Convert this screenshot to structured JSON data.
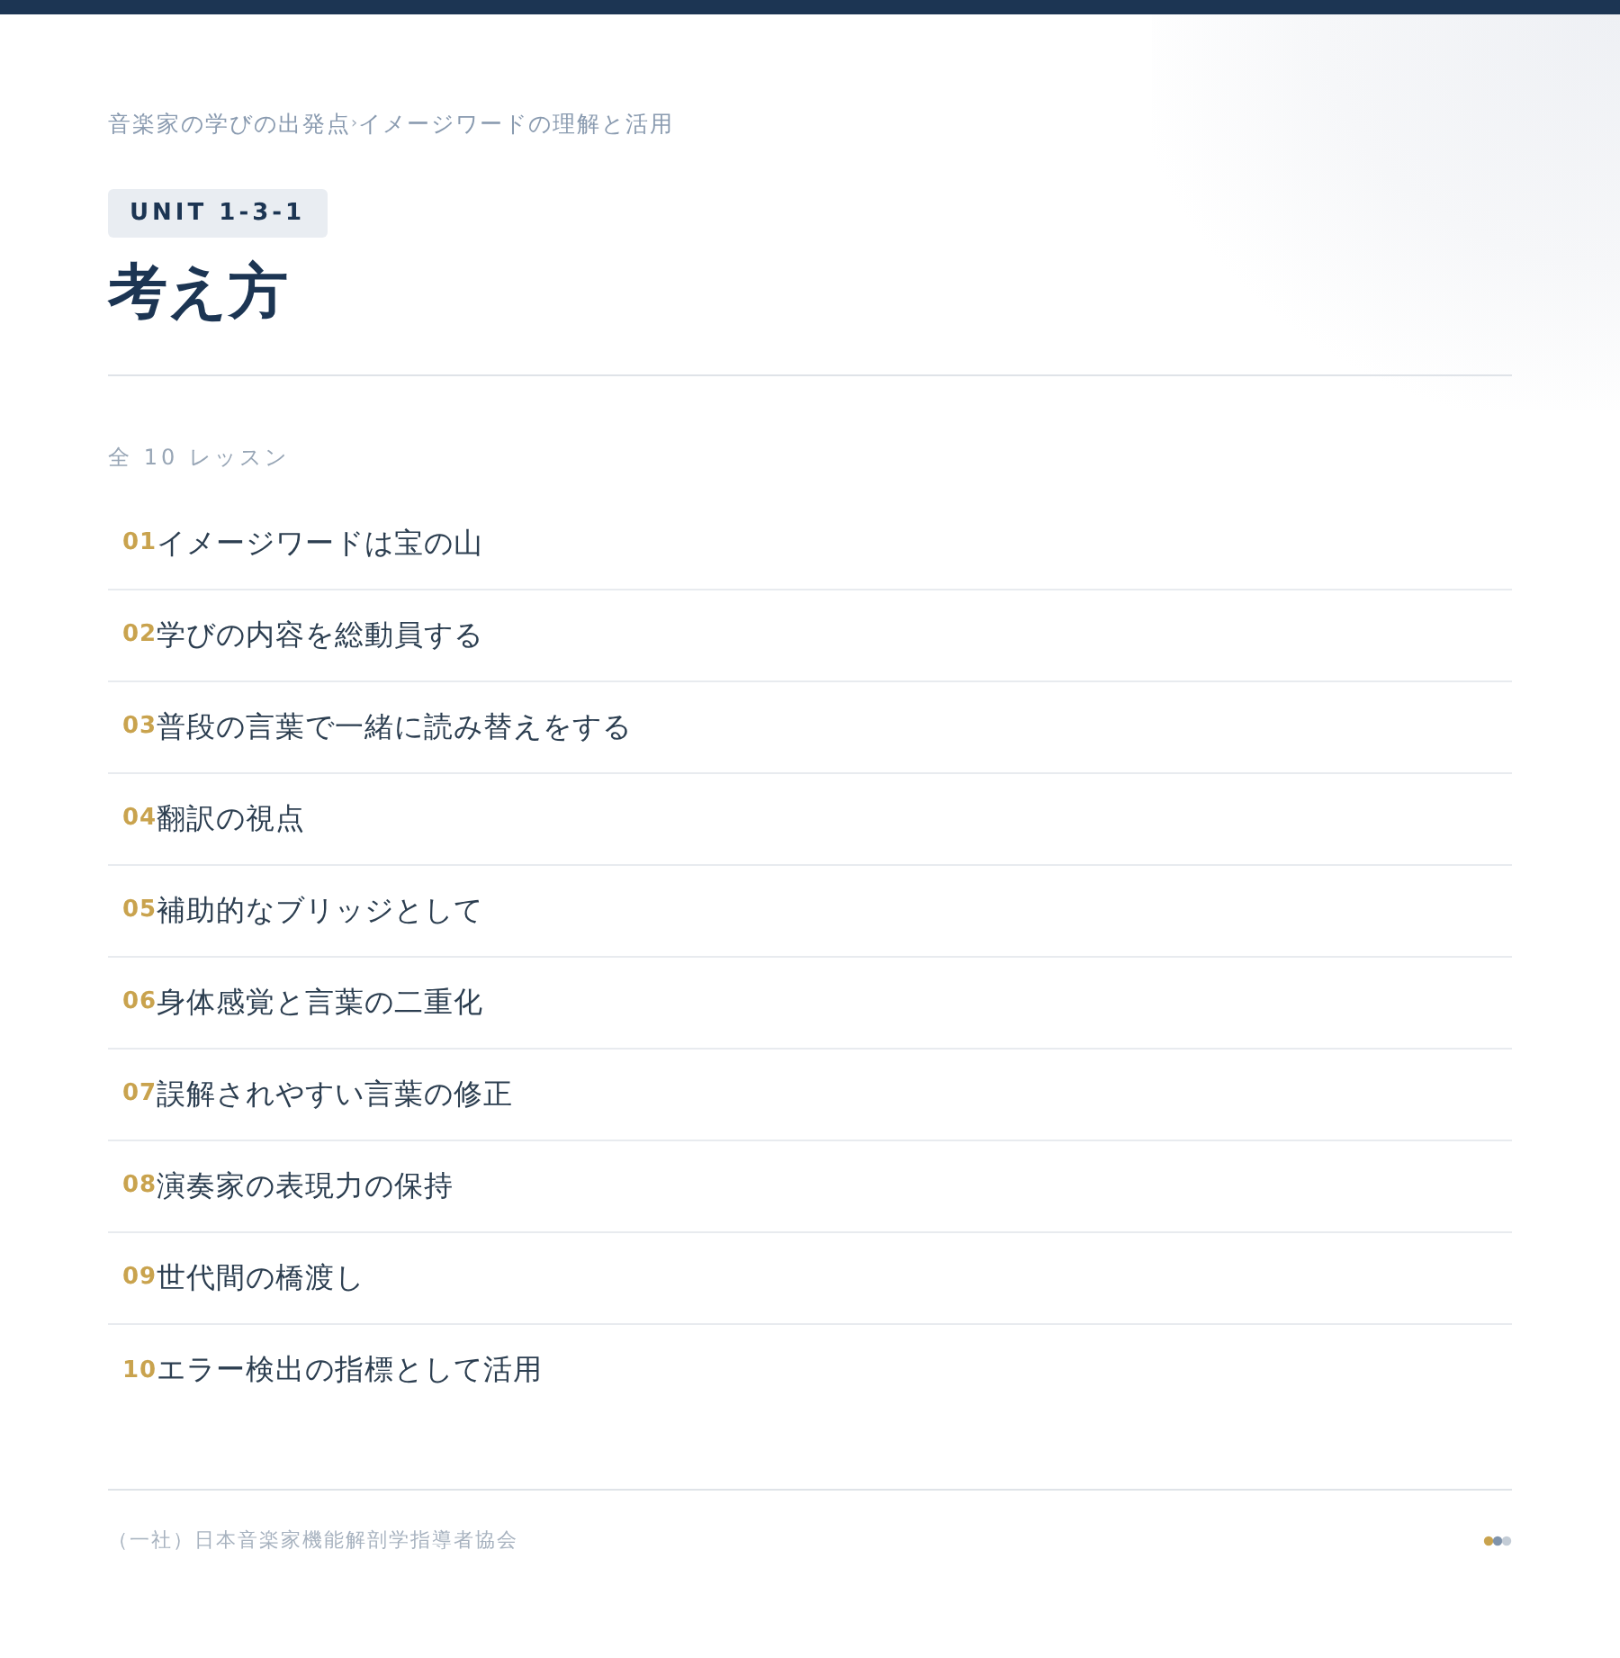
{
  "breadcrumb": {
    "items": [
      "音楽家の学びの出発点",
      "イメージワードの理解と活用"
    ],
    "separator": "›"
  },
  "unit_badge": "UNIT 1-3-1",
  "title": "考え方",
  "lesson_count": "全 10 レッスン",
  "lessons": [
    {
      "number": "01",
      "title": "イメージワードは宝の山"
    },
    {
      "number": "02",
      "title": "学びの内容を総動員する"
    },
    {
      "number": "03",
      "title": "普段の言葉で一緒に読み替えをする"
    },
    {
      "number": "04",
      "title": "翻訳の視点"
    },
    {
      "number": "05",
      "title": "補助的なブリッジとして"
    },
    {
      "number": "06",
      "title": "身体感覚と言葉の二重化"
    },
    {
      "number": "07",
      "title": "誤解されやすい言葉の修正"
    },
    {
      "number": "08",
      "title": "演奏家の表現力の保持"
    },
    {
      "number": "09",
      "title": "世代間の橋渡し"
    },
    {
      "number": "10",
      "title": "エラー検出の指標として活用"
    }
  ],
  "footer": {
    "organization": "（一社）日本音楽家機能解剖学指導者協会"
  }
}
